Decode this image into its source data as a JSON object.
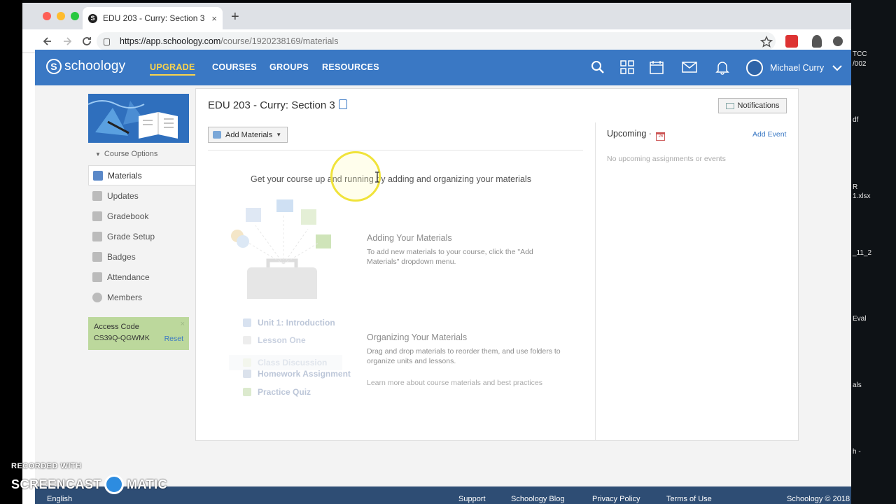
{
  "browser": {
    "tab_title": "EDU 203 - Curry: Section 3 | S",
    "tab_favicon": "S",
    "tab_close": "×",
    "new_tab": "+",
    "url_domain": "https://app.schoology.com",
    "url_path": "/course/1920238169/materials"
  },
  "nav": {
    "logo": "schoology",
    "logo_mark": "S",
    "links": [
      "UPGRADE",
      "COURSES",
      "GROUPS",
      "RESOURCES"
    ],
    "user_name": "Michael Curry"
  },
  "sidebar": {
    "course_options": "Course Options",
    "items": [
      "Materials",
      "Updates",
      "Gradebook",
      "Grade Setup",
      "Badges",
      "Attendance",
      "Members"
    ],
    "access_code_label": "Access Code",
    "access_code": "CS39Q-QGWMK",
    "reset": "Reset",
    "close": "×"
  },
  "main": {
    "course_title": "EDU 203 - Curry: Section 3",
    "notifications": "Notifications",
    "add_materials": "Add Materials",
    "headline": "Get your course up and running by adding and organizing your materials",
    "adding_title": "Adding Your Materials",
    "adding_desc": "To add new materials to your course, click the \"Add Materials\" dropdown menu.",
    "organizing_title": "Organizing Your Materials",
    "organizing_desc": "Drag and drop materials to reorder them, and use folders to organize units and lessons.",
    "learn_more": "Learn more about course materials and best practices",
    "ghost_items": [
      "Unit 1: Introduction",
      "Lesson One",
      "Class Discussion",
      "Homework Assignment",
      "Practice Quiz"
    ]
  },
  "upcoming": {
    "title": "Upcoming ·",
    "cal_day": "26",
    "add_event": "Add Event",
    "empty": "No upcoming assignments or events"
  },
  "footer": {
    "language": "English",
    "links": [
      "Support",
      "Schoology Blog",
      "Privacy Policy",
      "Terms of Use"
    ],
    "copyright": "Schoology © 2018"
  },
  "desktop_labels": [
    "TCC",
    "/002",
    "df",
    "R",
    "1.xlsx",
    "_11_2",
    "Eval",
    "als",
    "h -"
  ],
  "watermark": {
    "line1": "RECORDED WITH",
    "left": "SCREENCAST",
    "right": "MATIC"
  },
  "colors": {
    "brand_blue": "#3a78c4",
    "active_link": "#fbd54c",
    "access_bg": "#bcd89c"
  }
}
